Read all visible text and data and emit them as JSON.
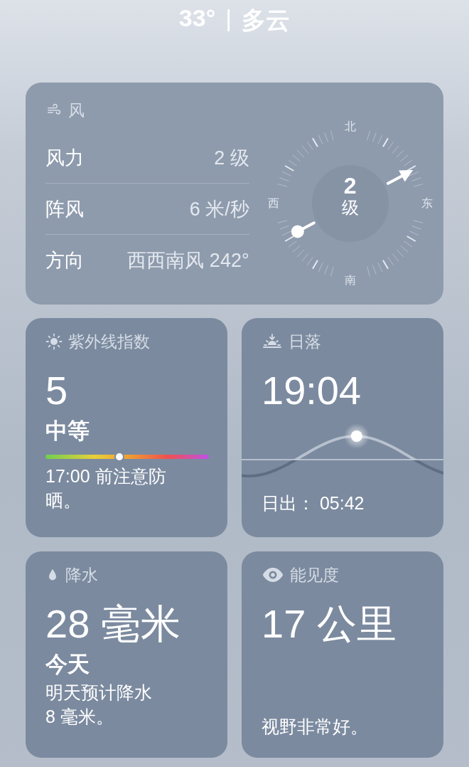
{
  "header": {
    "temperature": "33°",
    "separator": "|",
    "condition": "多云"
  },
  "wind": {
    "title": "风",
    "rows": [
      {
        "label": "风力",
        "value": "2 级"
      },
      {
        "label": "阵风",
        "value": "6 米/秒"
      },
      {
        "label": "方向",
        "value": "西西南风 242°"
      }
    ],
    "compass": {
      "speed": "2",
      "unit": "级",
      "north": "北",
      "east": "东",
      "south": "南",
      "west": "西"
    }
  },
  "uv": {
    "title": "紫外线指数",
    "value": "5",
    "category": "中等",
    "level": 0.45,
    "note": "17:00 前注意防晒。"
  },
  "sunset": {
    "title": "日落",
    "time": "19:04",
    "level": 0.57,
    "sunrise": "日出： 05:42"
  },
  "precipitation": {
    "title": "降水",
    "amount": "28 毫米",
    "period": "今天",
    "note": "明天预计降水 8 毫米。"
  },
  "visibility": {
    "title": "能见度",
    "distance": "17 公里",
    "note": "视野非常好。"
  }
}
